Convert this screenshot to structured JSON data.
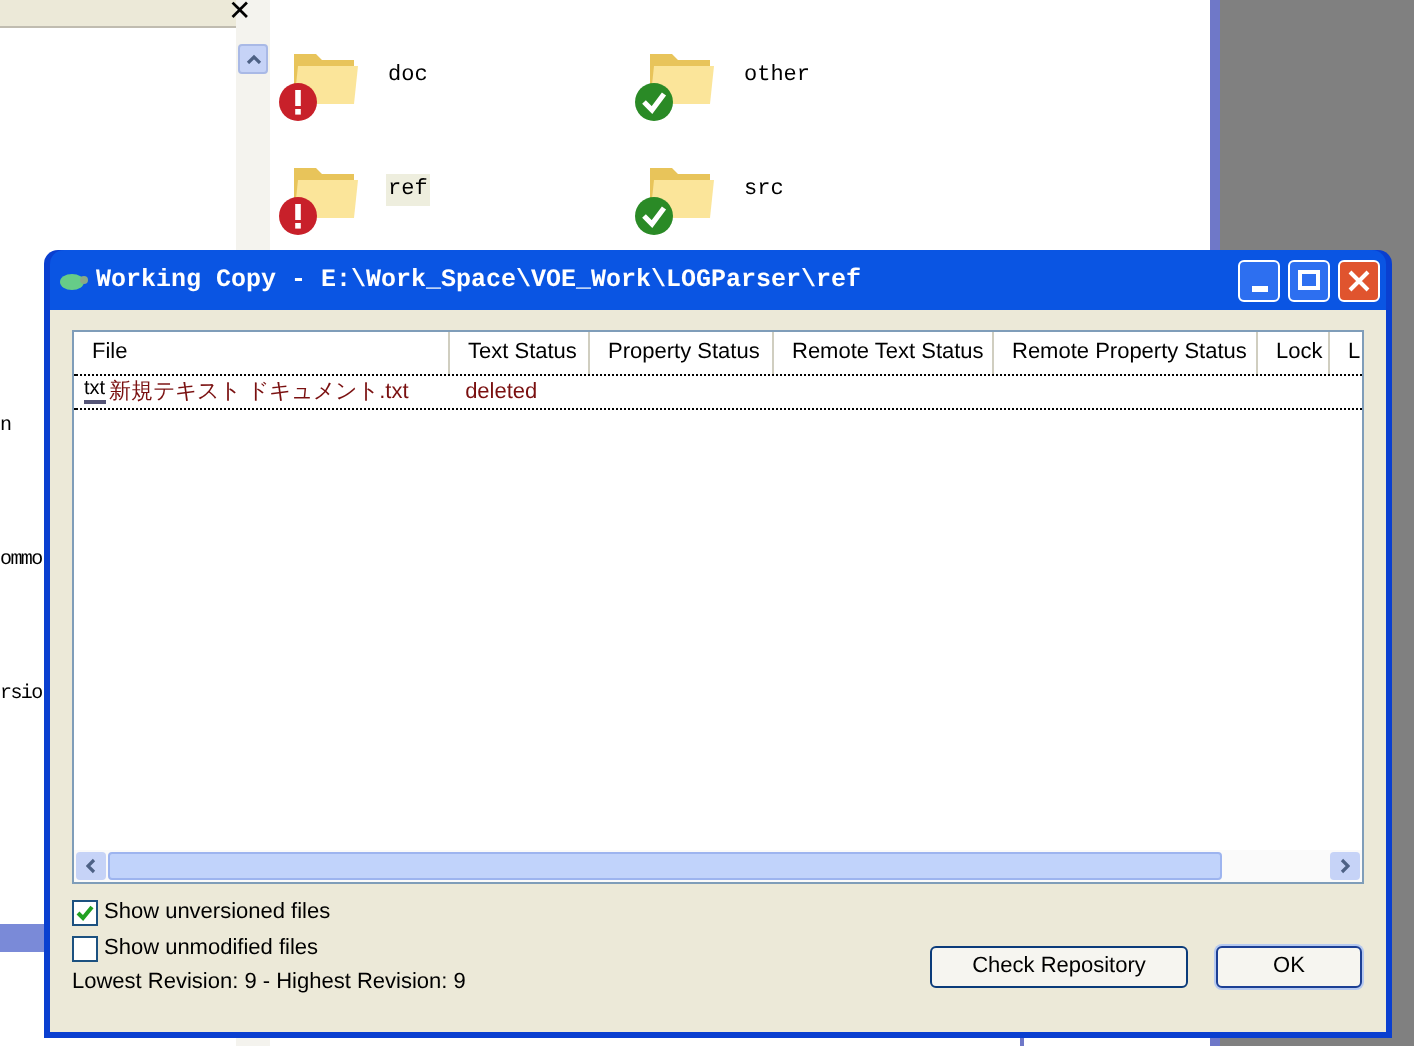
{
  "explorer": {
    "close_glyph": "✕",
    "left_fragments": [
      "n",
      "ommo",
      "rsio"
    ],
    "folders": [
      {
        "name": "doc",
        "kind": "error",
        "selected": false
      },
      {
        "name": "other",
        "kind": "ok",
        "selected": false
      },
      {
        "name": "ref",
        "kind": "error",
        "selected": true
      },
      {
        "name": "src",
        "kind": "ok",
        "selected": false
      }
    ]
  },
  "dialog": {
    "title": "Working Copy - E:\\Work_Space\\VOE_Work\\LOGParser\\ref",
    "columns": [
      "File",
      "Text Status",
      "Property Status",
      "Remote Text Status",
      "Remote Property Status",
      "Lock",
      "L"
    ],
    "rows": [
      {
        "icon_text": "txt",
        "file": "新規テキスト ドキュメント.txt",
        "text_status": "deleted"
      }
    ],
    "checkboxes": [
      {
        "label": "Show unversioned files",
        "checked": true
      },
      {
        "label": "Show unmodified files",
        "checked": false
      }
    ],
    "revision": "Lowest Revision: 9 - Highest Revision: 9",
    "buttons": [
      {
        "label": "Check Repository",
        "default": false
      },
      {
        "label": "OK",
        "default": true
      }
    ]
  }
}
